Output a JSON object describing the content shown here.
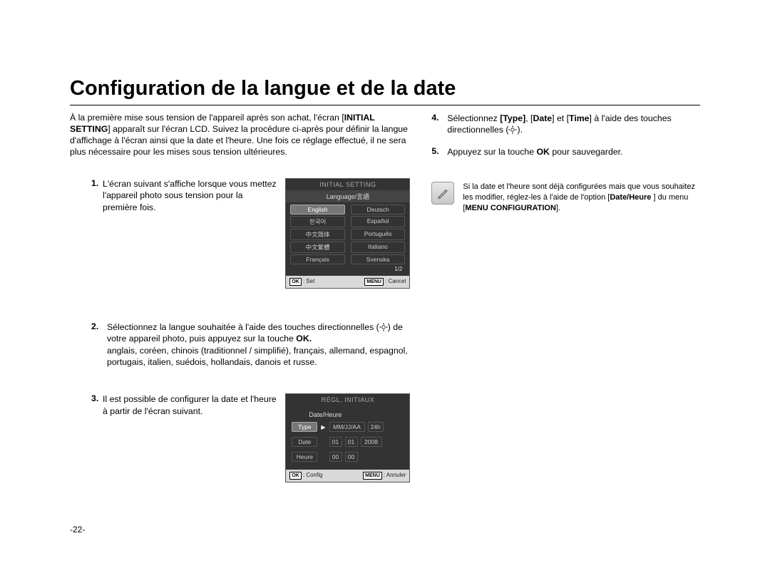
{
  "title": "Configuration de la langue et de la date",
  "intro_parts": {
    "p1a": "À la première mise sous tension de l'appareil après son achat, l'écran [",
    "p1b": "INITIAL SETTING",
    "p1c": "] apparaît sur l'écran LCD. Suivez la procédure ci-après pour définir la langue d'affichage à l'écran ainsi que la date et l'heure. Une fois ce réglage effectué, il ne sera plus nécessaire pour les mises sous tension ultérieures."
  },
  "step1": {
    "num": "1.",
    "text": "L'écran suivant s'affiche lorsque vous mettez l'appareil photo sous tension pour la première fois."
  },
  "lcd1": {
    "title": "INITIAL SETTING",
    "sub": "Language/言語",
    "langs": [
      "English",
      "Deutsch",
      "한국어",
      "Español",
      "中文简体",
      "Português",
      "中文繁體",
      "Italiano",
      "Français",
      "Svenska"
    ],
    "pager": "1/2",
    "ok_key": "OK",
    "ok_label": ": Set",
    "menu_key": "MENU",
    "menu_label": ": Cancel"
  },
  "step2": {
    "num": "2.",
    "a": "Sélectionnez la langue souhaitée à l'aide des touches directionnelles (",
    "b": ") de votre appareil photo, puis appuyez sur la touche ",
    "okbold": "OK.",
    "langs_line": "anglais, coréen, chinois (traditionnel / simplifié), français, allemand, espagnol, portugais, italien, suédois, hollandais, danois et russe."
  },
  "step3": {
    "num": "3.",
    "text": "Il est possible de configurer la date et l'heure à partir de l'écran suivant."
  },
  "lcd2": {
    "title": "RÉGL. INITIAUX",
    "sub": "Date/Heure",
    "type_label": "Type",
    "type_val1": "MM/JJ/AA",
    "type_val2": "24h",
    "date_label": "Date",
    "date_vals": [
      "01",
      "01",
      "2008"
    ],
    "time_label": "Heure",
    "time_vals": [
      "00",
      "00"
    ],
    "ok_key": "OK",
    "ok_label": ": Config",
    "menu_key": "MENU",
    "menu_label": ": Annuler"
  },
  "step4": {
    "num": "4.",
    "a": "Sélectionnez ",
    "b1": "Type",
    "c1": ", [",
    "b2": "Date",
    "c2": "] et [",
    "b3": "Time",
    "d": "] à l'aide des touches directionnelles (",
    "e": ")."
  },
  "step5": {
    "num": "5.",
    "a": "Appuyez sur la touche ",
    "ok": "OK",
    "b": " pour sauvegarder."
  },
  "note": {
    "a": "Si la date et l'heure sont déjà configurées mais que vous souhaitez les modifier, réglez-les à l'aide de l'option [",
    "b": "Date/Heure ",
    "c": "] du menu [",
    "d": "MENU CONFIGURATION",
    "e": "]."
  },
  "page_number": "-22-"
}
